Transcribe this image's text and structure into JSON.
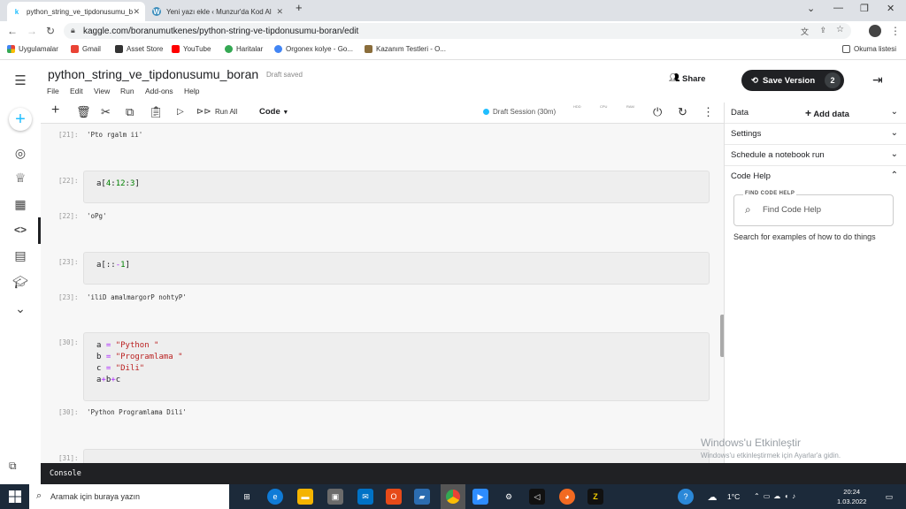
{
  "browser": {
    "tabs": [
      {
        "title": "python_string_ve_tipdonusumu_b",
        "favicon": "k",
        "active": true
      },
      {
        "title": "Yeni yazı ekle ‹ Munzur'da Kod Al",
        "favicon": "W",
        "active": false
      }
    ],
    "new_tab": "+",
    "url": "kaggle.com/boranumutkenes/python-string-ve-tipdonusumu-boran/edit",
    "bookmarks": [
      "Uygulamalar",
      "Gmail",
      "Asset Store",
      "YouTube",
      "Haritalar",
      "Orgonex kolye - Go...",
      "Kazanım Testleri - O..."
    ],
    "reading_list": "Okuma listesi"
  },
  "notebook": {
    "title": "python_string_ve_tipdonusumu_boran",
    "status": "Draft saved",
    "menu": [
      "File",
      "Edit",
      "View",
      "Run",
      "Add-ons",
      "Help"
    ],
    "share_label": "Share",
    "save_label": "Save Version",
    "save_count": "2",
    "run_all": "Run All",
    "cell_type": "Code",
    "session": "Draft Session (30m)",
    "meters": [
      "HDD",
      "CPU",
      "RAM"
    ]
  },
  "cells": [
    {
      "out_prompt": "[21]:",
      "output": "'Pto rgalm ii'"
    },
    {
      "in_prompt": "[22]:",
      "code": "a[4:12:3]",
      "out_prompt": "[22]:",
      "output": "'oPg'"
    },
    {
      "in_prompt": "[23]:",
      "code": "a[::-1]",
      "out_prompt": "[23]:",
      "output": "'iliD amalmargorP nohtyP'"
    },
    {
      "in_prompt": "[30]:",
      "lines": [
        "a = \"Python \"",
        "b = \"Programlama \"",
        "c = \"Dili\"",
        "a+b+c"
      ],
      "out_prompt": "[30]:",
      "output": "'Python Programlama Dili'"
    },
    {
      "in_prompt": "[31]:"
    }
  ],
  "right_panel": {
    "data": "Data",
    "add_data": "Add data",
    "settings": "Settings",
    "schedule": "Schedule a notebook run",
    "code_help": "Code Help",
    "find_label": "FIND CODE HELP",
    "find_placeholder": "Find Code Help",
    "hint": "Search for examples of how to do things"
  },
  "console_label": "Console",
  "watermark": {
    "title": "Windows'u Etkinleştir",
    "sub": "Windows'u etkinleştirmek için Ayarlar'a gidin."
  },
  "taskbar": {
    "search_placeholder": "Aramak için buraya yazın",
    "weather": "1°C",
    "time": "20:24",
    "date": "1.03.2022"
  },
  "colors": {
    "accent": "#20beff",
    "dark": "#202124",
    "string": "#ba2121",
    "number": "#008000"
  }
}
